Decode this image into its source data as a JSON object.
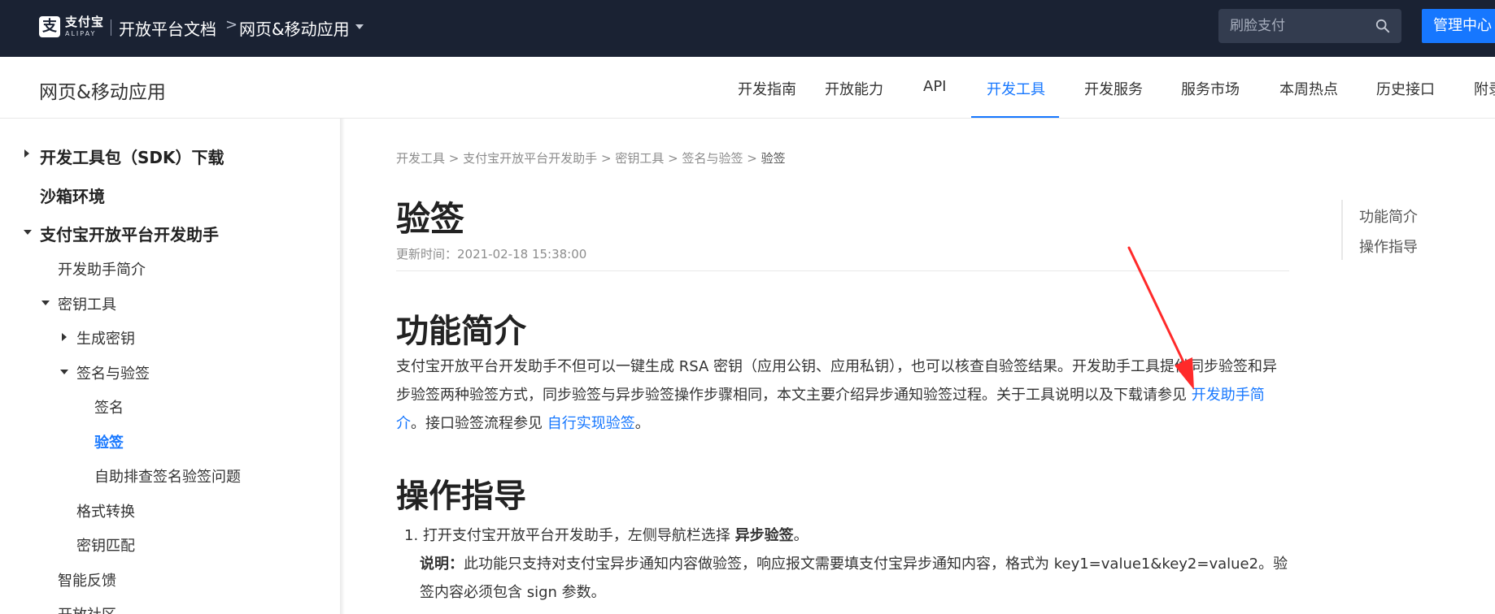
{
  "topbar": {
    "logo_cn": "支付宝",
    "logo_en": "ALIPAY",
    "title": "开放平台文档",
    "crumb_sep": ">",
    "section": "网页&移动应用",
    "search_placeholder": "刷脸支付",
    "manage_label": "管理中心"
  },
  "subheader": {
    "title": "网页&移动应用",
    "nav": [
      {
        "label": "开发指南"
      },
      {
        "label": "开放能力"
      },
      {
        "label": "API"
      },
      {
        "label": "开发工具"
      },
      {
        "label": "开发服务"
      },
      {
        "label": "服务市场"
      },
      {
        "label": "本周热点"
      },
      {
        "label": "历史接口"
      },
      {
        "label": "附录"
      }
    ],
    "active_index": 3
  },
  "sidebar": {
    "items": [
      {
        "label": "开发工具包（SDK）下载"
      },
      {
        "label": "沙箱环境"
      },
      {
        "label": "支付宝开放平台开发助手"
      },
      {
        "label": "开发助手简介"
      },
      {
        "label": "密钥工具"
      },
      {
        "label": "生成密钥"
      },
      {
        "label": "签名与验签"
      },
      {
        "label": "签名"
      },
      {
        "label": "验签"
      },
      {
        "label": "自助排查签名验签问题"
      },
      {
        "label": "格式转换"
      },
      {
        "label": "密钥匹配"
      },
      {
        "label": "智能反馈"
      },
      {
        "label": "开放社区"
      }
    ]
  },
  "breadcrumb": {
    "items": [
      "开发工具",
      "支付宝开放平台开发助手",
      "密钥工具",
      "签名与验签",
      "验签"
    ],
    "sep": ">"
  },
  "page": {
    "title": "验签",
    "update_time": "更新时间：2021-02-18 15:38:00"
  },
  "section1": {
    "heading": "功能简介",
    "text_a": "支付宝开放平台开发助手不但可以一键生成 RSA 密钥（应用公钥、应用私钥），也可以核查自验签结果。开发助手工具提供同步验签和异步验签两种验签方式，同步验签与异步验签操作步骤相同，本文主要介绍异步通知验签过程。关于工具说明以及下载请参见 ",
    "link_a": "开发助手简介",
    "text_b": "。接口验签流程参见 ",
    "link_b": "自行实现验签",
    "text_c": "。"
  },
  "section2": {
    "heading": "操作指导",
    "step1_prefix": "1. 打开支付宝开放平台开发助手，左侧导航栏选择 ",
    "step1_bold": "异步验签",
    "step1_suffix": "。",
    "note_label": "说明：",
    "note_text": "此功能只支持对支付宝异步通知内容做验签，响应报文需要填支付宝异步通知内容，格式为 key1=value1&key2=value2。验签内容必须包含 sign 参数。"
  },
  "toc": {
    "items": [
      {
        "label": "功能简介"
      },
      {
        "label": "操作指导"
      }
    ]
  },
  "colors": {
    "topbar_bg": "#1a2233",
    "accent": "#1677ff",
    "annotation": "#ff2a2a"
  }
}
